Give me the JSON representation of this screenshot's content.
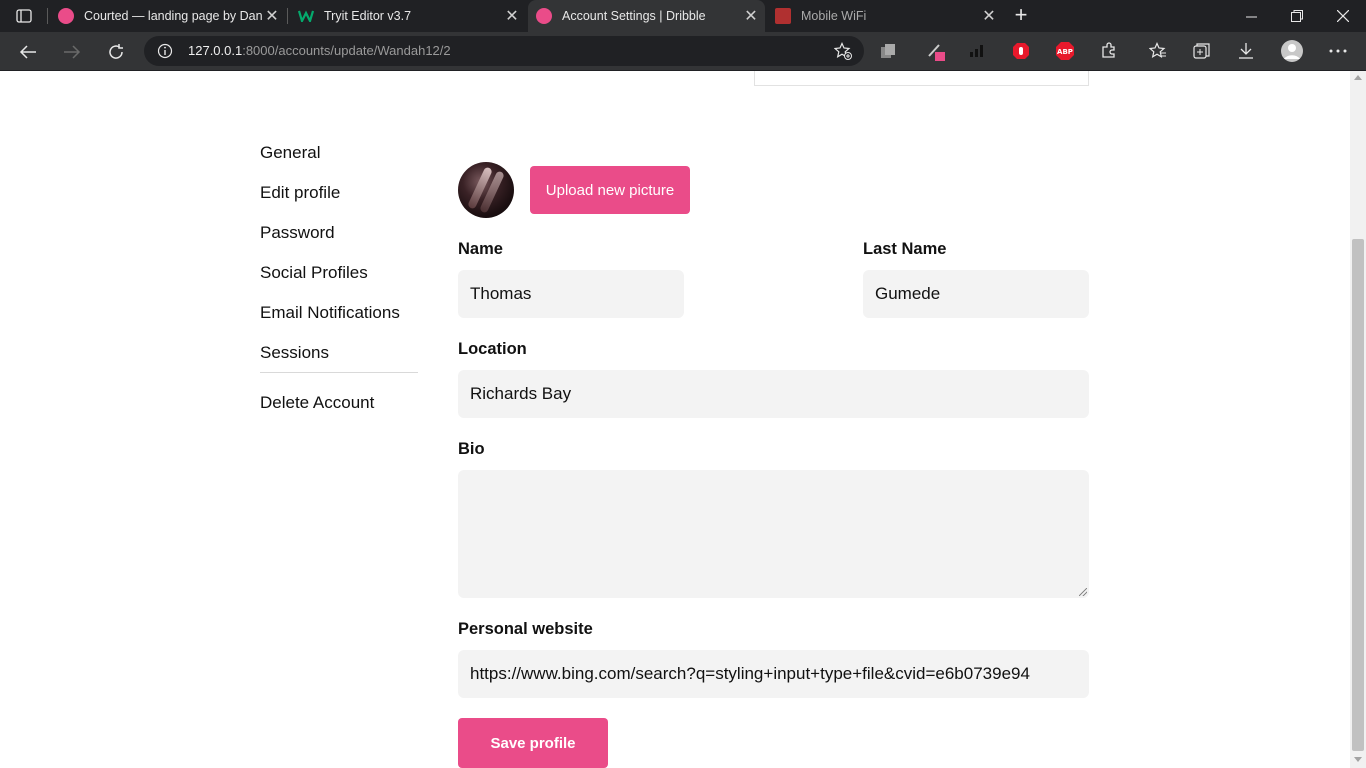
{
  "browser": {
    "tabs": [
      {
        "title": "Courted — landing page by Dan",
        "favicon": "dribbble-icon",
        "active": false
      },
      {
        "title": "Tryit Editor v3.7",
        "favicon": "w3schools-icon",
        "active": false
      },
      {
        "title": "Account Settings | Dribble",
        "favicon": "dribbble-icon",
        "active": true
      },
      {
        "title": "Mobile WiFi",
        "favicon": "huawei-icon",
        "active": false
      }
    ],
    "address": {
      "host": "127.0.0.1",
      "path": ":8000/accounts/update/Wandah12/2"
    },
    "colors": {
      "accent": "#ea4c89",
      "chrome_dark": "#202124",
      "chrome_toolbar": "#333436"
    }
  },
  "sidebar": {
    "items": [
      {
        "label": "General"
      },
      {
        "label": "Edit profile"
      },
      {
        "label": "Password"
      },
      {
        "label": "Social Profiles"
      },
      {
        "label": "Email Notifications"
      },
      {
        "label": "Sessions"
      }
    ],
    "delete_label": "Delete Account"
  },
  "profile": {
    "upload_label": "Upload new picture",
    "name_label": "Name",
    "name_value": "Thomas",
    "last_name_label": "Last Name",
    "last_name_value": "Gumede",
    "location_label": "Location",
    "location_value": "Richards Bay",
    "bio_label": "Bio",
    "bio_value": "",
    "website_label": "Personal website",
    "website_value": "https://www.bing.com/search?q=styling+input+type+file&cvid=e6b0739e94",
    "save_label": "Save profile"
  }
}
